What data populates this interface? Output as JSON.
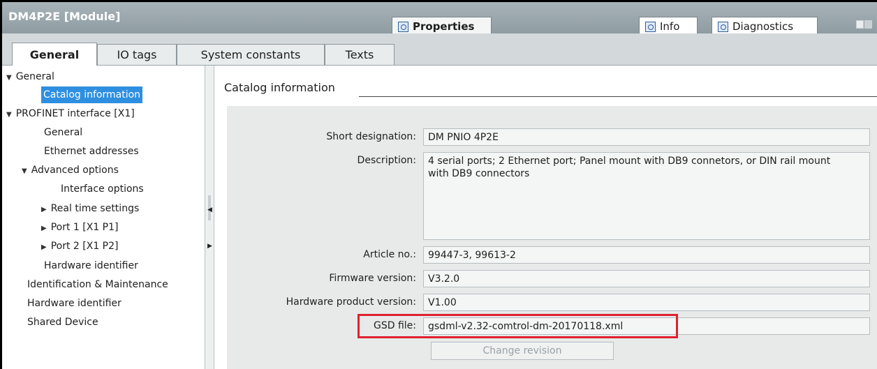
{
  "window": {
    "title": "DM4P2E [Module]",
    "tabs": [
      {
        "label": "Properties",
        "icon": "properties-icon"
      },
      {
        "label": "Info",
        "icon": "info-icon"
      },
      {
        "label": "Diagnostics",
        "icon": "diagnostics-icon"
      }
    ]
  },
  "tabs": [
    {
      "label": "General"
    },
    {
      "label": "IO tags"
    },
    {
      "label": "System constants"
    },
    {
      "label": "Texts"
    }
  ],
  "nav": [
    {
      "label": "General"
    },
    {
      "label": "Catalog information"
    },
    {
      "label": "PROFINET interface [X1]"
    },
    {
      "label": "General"
    },
    {
      "label": "Ethernet addresses"
    },
    {
      "label": "Advanced options"
    },
    {
      "label": "Interface options"
    },
    {
      "label": "Real time settings"
    },
    {
      "label": "Port 1 [X1 P1]"
    },
    {
      "label": "Port 2 [X1 P2]"
    },
    {
      "label": "Hardware identifier"
    },
    {
      "label": "Identification & Maintenance"
    },
    {
      "label": "Hardware identifier"
    },
    {
      "label": "Shared Device"
    }
  ],
  "content": {
    "section_title": "Catalog information",
    "short_designation": {
      "label": "Short designation:",
      "value": "DM PNIO 4P2E"
    },
    "description": {
      "label": "Description:",
      "value": "4 serial ports; 2 Ethernet port; Panel mount with DB9 connetors, or DIN rail mount with DB9 connectors"
    },
    "article_no": {
      "label": "Article no.:",
      "value": "99447-3, 99613-2"
    },
    "firmware_version": {
      "label": "Firmware version:",
      "value": "V3.2.0"
    },
    "hw_product_version": {
      "label": "Hardware product version:",
      "value": "V1.00"
    },
    "gsd_file": {
      "label": "GSD file:",
      "value": "gsdml-v2.32-comtrol-dm-20170118.xml"
    },
    "change_revision": "Change revision"
  },
  "colors": {
    "selection": "#2e8fe0",
    "highlight": "#e0202e",
    "title_bar": "#9aa6ab"
  }
}
